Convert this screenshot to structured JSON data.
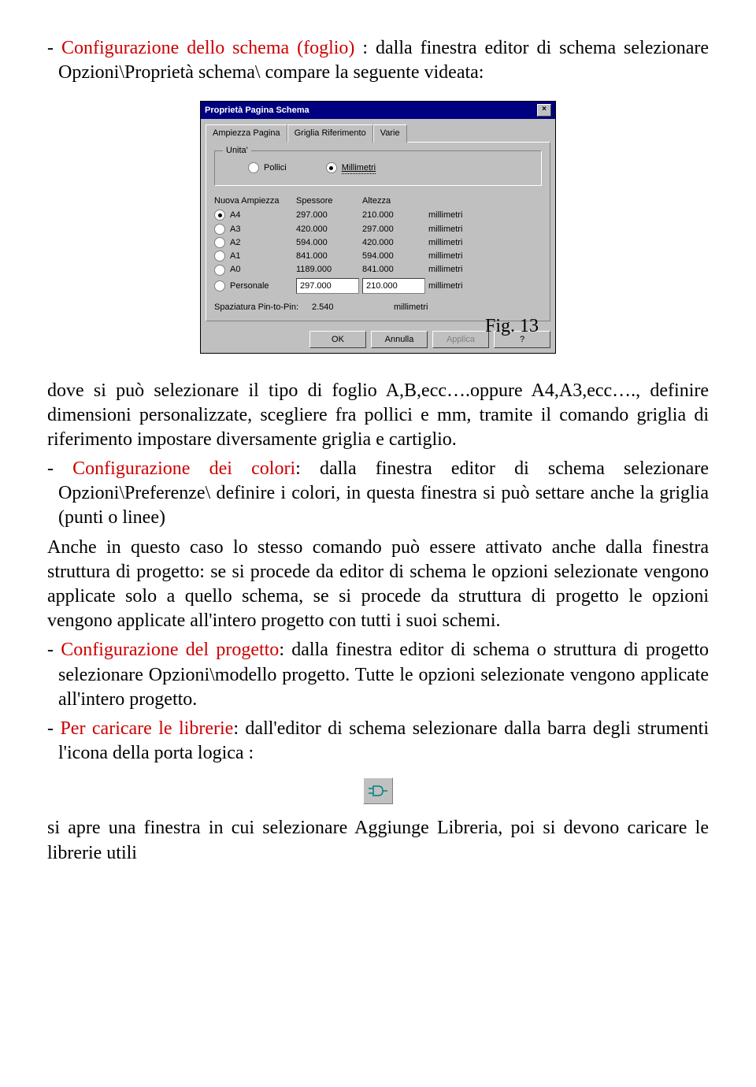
{
  "intro": {
    "dash": "- ",
    "title_red": "Configurazione dello schema (foglio)",
    "rest": " : dalla finestra editor di schema selezionare Opzioni\\Proprietà schema\\ compare la seguente videata:"
  },
  "dialog": {
    "title": "Proprietà Pagina Schema",
    "tabs": [
      "Ampiezza Pagina",
      "Griglia Riferimento",
      "Varie"
    ],
    "unita_label": "Unita'",
    "units": [
      {
        "label": "Pollici",
        "checked": false
      },
      {
        "label": "Millimetri",
        "checked": true
      }
    ],
    "col_headers": [
      "Nuova Ampiezza",
      "Spessore",
      "Altezza",
      ""
    ],
    "rows": [
      {
        "name": "A4",
        "w": "297.000",
        "h": "210.000",
        "unit": "millimetri",
        "checked": true,
        "editable": false
      },
      {
        "name": "A3",
        "w": "420.000",
        "h": "297.000",
        "unit": "millimetri",
        "checked": false,
        "editable": false
      },
      {
        "name": "A2",
        "w": "594.000",
        "h": "420.000",
        "unit": "millimetri",
        "checked": false,
        "editable": false
      },
      {
        "name": "A1",
        "w": "841.000",
        "h": "594.000",
        "unit": "millimetri",
        "checked": false,
        "editable": false
      },
      {
        "name": "A0",
        "w": "1189.000",
        "h": "841.000",
        "unit": "millimetri",
        "checked": false,
        "editable": false
      },
      {
        "name": "Personale",
        "w": "297.000",
        "h": "210.000",
        "unit": "millimetri",
        "checked": false,
        "editable": true
      }
    ],
    "spacing_label": "Spaziatura Pin-to-Pin:",
    "spacing_value": "2.540",
    "spacing_unit": "millimetri",
    "buttons": {
      "ok": "OK",
      "cancel": "Annulla",
      "apply": "Applica",
      "help": "?"
    }
  },
  "fig": "Fig. 13",
  "body1": "dove si può selezionare il tipo di foglio A,B,ecc….oppure A4,A3,ecc…., definire dimensioni personalizzate, scegliere fra pollici e mm, tramite il comando griglia di riferimento impostare diversamente griglia e cartiglio.",
  "sec_colori": {
    "dash": "- ",
    "title": "Configurazione dei colori",
    "rest": ": dalla finestra editor di schema selezionare Opzioni\\Preferenze\\ definire i colori, in questa finestra si può settare anche la griglia (punti o linee)"
  },
  "body2": "Anche in questo caso lo stesso comando può essere attivato anche dalla finestra struttura di progetto: se si procede da editor di schema le opzioni selezionate vengono applicate solo a quello schema, se si procede da struttura di progetto le opzioni vengono applicate all'intero progetto con tutti i suoi schemi.",
  "sec_progetto": {
    "dash": "- ",
    "title": "Configurazione del progetto",
    "rest": ": dalla finestra editor di schema o struttura di progetto selezionare Opzioni\\modello progetto. Tutte le opzioni selezionate vengono applicate all'intero progetto."
  },
  "sec_librerie": {
    "dash": "- ",
    "title": "Per caricare le librerie",
    "rest": ": dall'editor di schema selezionare dalla barra degli strumenti l'icona della porta logica :"
  },
  "footer": "si apre una finestra in cui selezionare Aggiunge Libreria, poi si devono caricare le librerie utili"
}
